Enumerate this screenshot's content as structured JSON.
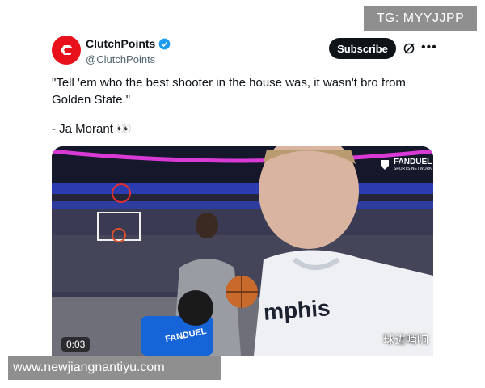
{
  "watermarks": {
    "top_right": "TG: MYYJJPP",
    "bottom_left": "www.newjiangnantiyu.com"
  },
  "account": {
    "name": "ClutchPoints",
    "handle": "@ClutchPoints",
    "avatar_icon": "clutchpoints-logo",
    "verified_icon": "verified-badge-icon",
    "brand_color": "#e8111b",
    "verified_color": "#1d9bf0"
  },
  "actions": {
    "subscribe_label": "Subscribe",
    "grok_icon": "grok-icon",
    "more_icon": "more-icon"
  },
  "tweet": {
    "line1": "\"Tell 'em who the best shooter in the house was, it wasn't bro from",
    "line2": "Golden State.\"",
    "author": "- Ja Morant 👀"
  },
  "video": {
    "timestamp": "0:03",
    "overlay_brand_line1": "FANDUEL",
    "overlay_brand_line2": "SPORTS NETWORK",
    "mic_brand": "FANDUEL",
    "jersey_text": "mphis",
    "caption": "球进哨响"
  }
}
